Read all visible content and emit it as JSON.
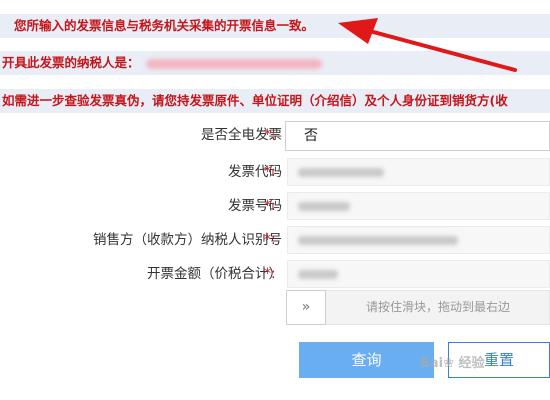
{
  "notice": {
    "consistent_message": "您所输入的发票信息与税务机关采集的开票信息一致。",
    "issuer_label": "开具此发票的纳税人是：",
    "verify_hint": "如需进一步查验发票真伪，请您持发票原件、单位证明（介绍信）及个人身份证到销货方(收"
  },
  "form": {
    "fields": [
      {
        "label": "是否全电发票",
        "required": "*:",
        "value": "否"
      },
      {
        "label": "发票代码",
        "required": "*:"
      },
      {
        "label": "发票号码",
        "required": "*:"
      },
      {
        "label": "销售方（收款方）纳税人识别号",
        "required": "*:"
      },
      {
        "label": "开票金额（价税合计）",
        "required": "*:"
      }
    ]
  },
  "slider": {
    "handle_glyph": "»",
    "hint": "请按住滑块，拖动到最右边"
  },
  "buttons": {
    "query": "查询",
    "reset": "重置"
  },
  "watermark": "Bai❀ 经验",
  "colors": {
    "alert_red": "#c4151b",
    "banner_bg": "#e9edf5",
    "primary_blue": "#69aef0"
  },
  "icons": {
    "arrow": "red-arrow-icon"
  }
}
